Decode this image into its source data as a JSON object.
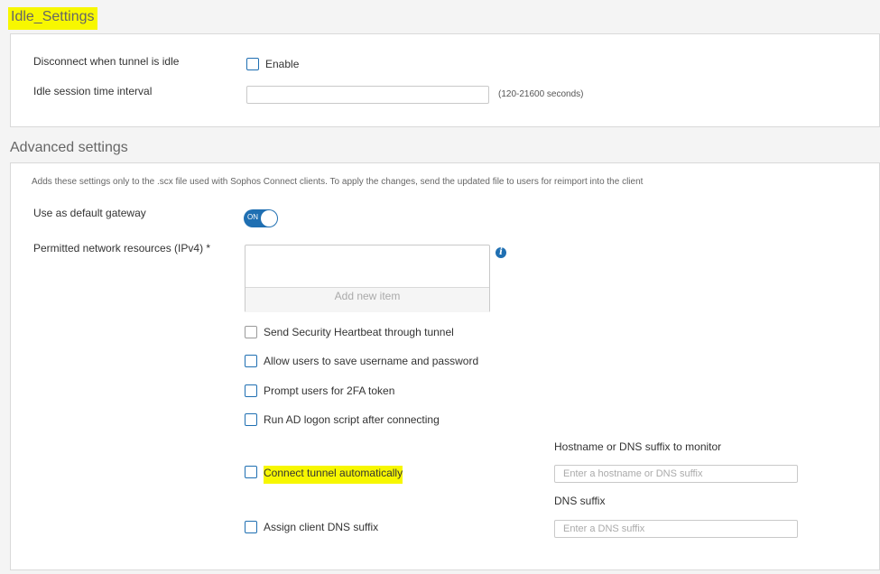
{
  "idle": {
    "title": "Idle_Settings",
    "disconnect_label": "Disconnect when tunnel is idle",
    "enable_label": "Enable",
    "interval_label": "Idle session time interval",
    "interval_value": "",
    "interval_hint": "(120-21600 seconds)"
  },
  "advanced": {
    "title": "Advanced settings",
    "description": "Adds these settings only to the .scx file used with Sophos Connect clients. To apply the changes, send the updated file to users for reimport into the client",
    "default_gateway_label": "Use as default gateway",
    "toggle_text": "ON",
    "permitted_label": "Permitted network resources (IPv4) *",
    "add_new_item": "Add new item",
    "checkboxes": [
      {
        "label": "Send Security Heartbeat through tunnel"
      },
      {
        "label": "Allow users to save username and password"
      },
      {
        "label": "Prompt users for 2FA token"
      },
      {
        "label": "Run AD logon script after connecting"
      },
      {
        "label": "Connect tunnel automatically"
      },
      {
        "label": "Assign client DNS suffix"
      }
    ],
    "hostname_label": "Hostname or DNS suffix to monitor",
    "hostname_placeholder": "Enter a hostname or DNS suffix",
    "dns_label": "DNS suffix",
    "dns_placeholder": "Enter a DNS suffix"
  }
}
